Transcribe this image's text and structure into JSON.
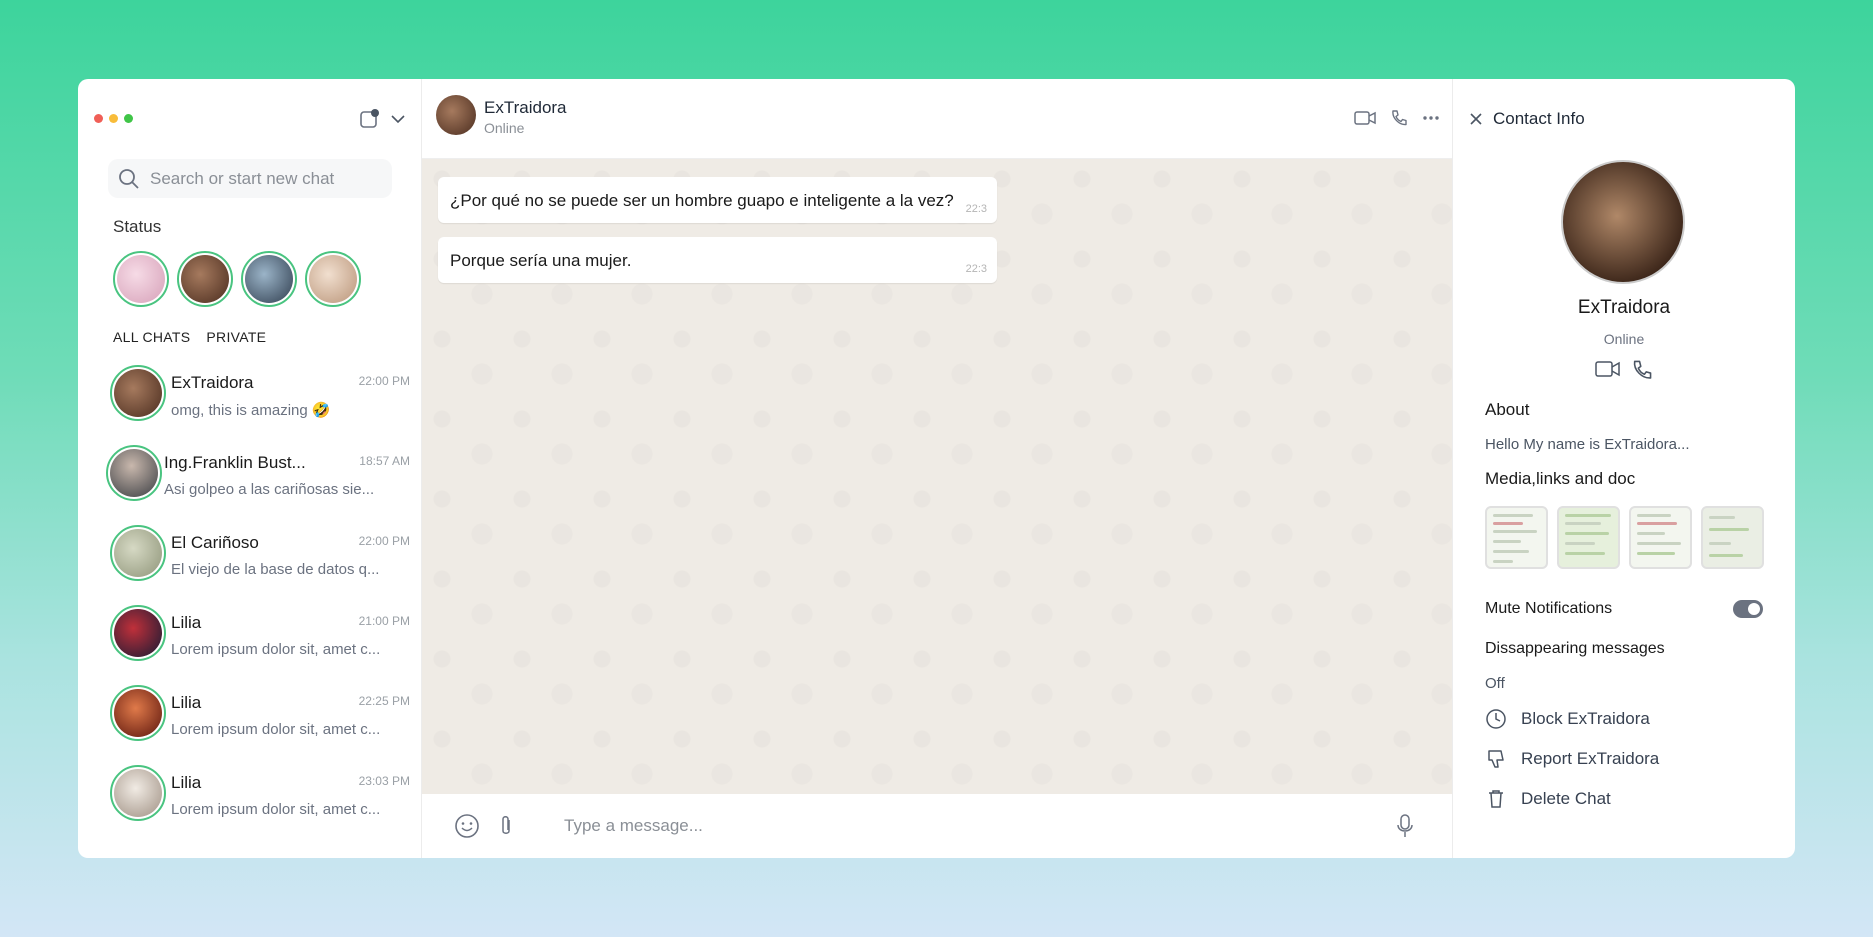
{
  "window": {
    "traffic_colors": [
      "#f05f57",
      "#f8bc3a",
      "#40c548"
    ]
  },
  "sidebar": {
    "search_placeholder": "Search or start new chat",
    "status_title": "Status",
    "filters": [
      "ALL CHATS",
      "PRIVATE"
    ],
    "status_avatars": [
      "#e9c4d3",
      "#7a5440",
      "#5a7388",
      "#d7b8a0"
    ],
    "chats": [
      {
        "name": "ExTraidora",
        "preview": "omg, this is amazing 🤣",
        "time": "22:00 PM",
        "avatar": "#7a5440"
      },
      {
        "name": "Ing.Franklin Bust...",
        "preview": "Asi golpeo a las cariñosas sie...",
        "time": "18:57 AM",
        "avatar": "#555a60"
      },
      {
        "name": "El Cariñoso",
        "preview": "El viejo de la base de datos q...",
        "time": "22:00 PM",
        "avatar": "#a9b09a"
      },
      {
        "name": "Lilia",
        "preview": "Lorem ipsum dolor sit, amet c...",
        "time": "21:00 PM",
        "avatar": "#2b3a6b"
      },
      {
        "name": "Lilia",
        "preview": "Lorem ipsum dolor sit, amet c...",
        "time": "22:25 PM",
        "avatar": "#9c2a1c"
      },
      {
        "name": "Lilia",
        "preview": "Lorem ipsum dolor sit, amet c...",
        "time": "23:03 PM",
        "avatar": "#d8cfc6"
      }
    ]
  },
  "conversation": {
    "name": "ExTraidora",
    "status": "Online",
    "messages": [
      {
        "text": "¿Por qué no se puede ser un hombre guapo e inteligente a la vez?",
        "time": "22:3"
      },
      {
        "text": "Porque sería una mujer.",
        "time": "22:3"
      }
    ],
    "input_placeholder": "Type a message..."
  },
  "contact": {
    "title": "Contact Info",
    "name": "ExTraidora",
    "status": "Online",
    "about_title": "About",
    "about_text": "Hello My name is ExTraidora...",
    "media_title": "Media,links and doc",
    "mute_label": "Mute Notifications",
    "mute_on": true,
    "disappearing_title": "Dissappearing messages",
    "disappearing_value": "Off",
    "block_label": "Block ExTraidora",
    "report_label": "Report ExTraidora",
    "delete_label": "Delete Chat"
  }
}
